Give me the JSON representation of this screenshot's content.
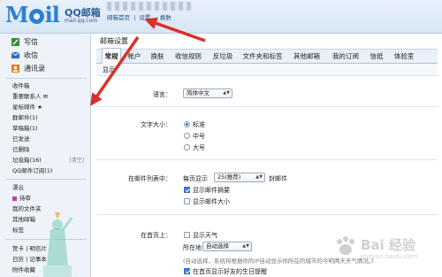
{
  "header": {
    "logo_text": "Mil",
    "brand": "QQ邮箱",
    "brand_sub": "mail.qq.com",
    "links": [
      "邮箱首页",
      "|",
      "设置",
      "-",
      "换肤"
    ],
    "colors": {
      "brand_blue": "#2a7fd4",
      "topbar": "#dfe9f5",
      "annotation_red": "#d9302a"
    }
  },
  "quick_actions": [
    {
      "label": "写信",
      "icon": "pencil-icon"
    },
    {
      "label": "收信",
      "icon": "inbox-icon"
    },
    {
      "label": "通讯录",
      "icon": "contacts-icon"
    }
  ],
  "folders": [
    {
      "label": "收件箱",
      "extra": ""
    },
    {
      "label": "重要联系人 ✉",
      "extra": ""
    },
    {
      "label": "星标邮件 ★",
      "extra": ""
    },
    {
      "label": "群邮件(1)",
      "extra": ""
    },
    {
      "label": "草稿箱(1)",
      "extra": ""
    },
    {
      "label": "已发送",
      "extra": ""
    },
    {
      "label": "已删除",
      "extra": ""
    },
    {
      "label": "垃圾箱(16)",
      "extra": "[清空]"
    },
    {
      "label": "QQ邮件订阅(1)",
      "extra": ""
    }
  ],
  "more": [
    {
      "label": "漂云",
      "extra": ""
    },
    {
      "label": "待审",
      "extra": "",
      "tag": true
    },
    {
      "label": "我的文件夹",
      "extra": ""
    },
    {
      "label": "其他邮箱",
      "extra": ""
    },
    {
      "label": "标签",
      "extra": ""
    }
  ],
  "bottom": [
    {
      "label": "贺卡 | 明信片",
      "extra": ""
    },
    {
      "label": "日历 | 记事本",
      "extra": ""
    },
    {
      "label": "附件收藏",
      "extra": ""
    }
  ],
  "main": {
    "title": "邮箱设置",
    "tabs": [
      "常规",
      "帐户",
      "换肤",
      "收信规则",
      "反垃圾",
      "文件夹和标签",
      "其他邮箱",
      "我的订阅",
      "信纸",
      "体验室"
    ],
    "active_tab": 0,
    "section": "显示",
    "language": {
      "label": "语言：",
      "value": "简体中文"
    },
    "font_size": {
      "label": "文字大小：",
      "options": [
        "标准",
        "中号",
        "大号"
      ],
      "selected": 0
    },
    "list_view": {
      "label": "在邮件列表中：",
      "per_page_prefix": "每页显示",
      "per_page_value": "25(推荐)",
      "per_page_suffix": "封邮件",
      "show_summary": "显示邮件摘要",
      "show_summary_checked": true,
      "show_size": "显示邮件大小",
      "show_size_checked": false
    },
    "homepage": {
      "label": "在首页上：",
      "show_weather": "显示天气",
      "show_weather_checked": false,
      "location_label": "所在地：",
      "location_value": "自动选择",
      "hint": "(自动选择，系统将根据你的IP自动显示你所在的城市的今明两天天气情况。)",
      "show_birthday": "在首页显示好友的生日提醒",
      "show_birthday_checked": true
    }
  },
  "watermark": {
    "text": "Bai 经验",
    "url": "jingyan.baidu.com"
  }
}
